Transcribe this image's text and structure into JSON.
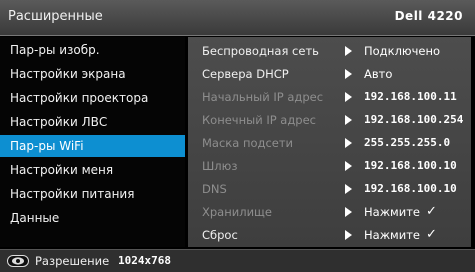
{
  "header": {
    "title": "Расширенные",
    "model": "Dell 4220"
  },
  "sidebar": {
    "items": [
      {
        "label": "Пар-ры изобр."
      },
      {
        "label": "Настройки экрана"
      },
      {
        "label": "Настройки проектора"
      },
      {
        "label": "Настройки ЛВС"
      },
      {
        "label": "Пар-ры WiFi",
        "active": true
      },
      {
        "label": "Настройки меня"
      },
      {
        "label": "Настройки питания"
      },
      {
        "label": "Данные"
      }
    ]
  },
  "panel": {
    "rows": [
      {
        "label": "Беспроводная сеть",
        "value": "Подключено",
        "enabled": true
      },
      {
        "label": "Сервера DHCP",
        "value": "Авто",
        "enabled": true
      },
      {
        "label": "Начальный IP адрес",
        "value": "192.168.100.11",
        "enabled": false
      },
      {
        "label": "Конечный IP адрес",
        "value": "192.168.100.254",
        "enabled": false
      },
      {
        "label": "Маска подсети",
        "value": "255.255.255.0",
        "enabled": false
      },
      {
        "label": "Шлюз",
        "value": "192.168.100.10",
        "enabled": false
      },
      {
        "label": "DNS",
        "value": "192.168.100.10",
        "enabled": false
      },
      {
        "label": "Хранилище",
        "value": "Нажмите",
        "check": "✓",
        "enabled": false
      },
      {
        "label": "Сброс",
        "value": "Нажмите",
        "check": "✓",
        "enabled": true
      }
    ]
  },
  "footer": {
    "resolution_label": "Разрешение",
    "resolution_value": "1024x768",
    "icon": "eye-icon"
  },
  "colors": {
    "accent": "#0d8fd1",
    "panel": "#474747",
    "dim_text": "#8e8e8e"
  }
}
